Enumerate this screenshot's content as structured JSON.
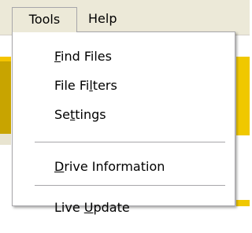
{
  "menubar": {
    "menus": [
      {
        "label": "Tools"
      },
      {
        "label": "Help"
      }
    ]
  },
  "dropdown": {
    "items": [
      {
        "pre": "",
        "mnemonic": "F",
        "post": "ind Files"
      },
      {
        "pre": "File Fi",
        "mnemonic": "l",
        "post": "ters"
      },
      {
        "pre": "Se",
        "mnemonic": "t",
        "post": "tings"
      },
      {
        "pre": "",
        "mnemonic": "D",
        "post": "rive Information"
      },
      {
        "pre": "Live ",
        "mnemonic": "U",
        "post": "pdate"
      }
    ]
  },
  "colors": {
    "menubar_bg": "#ece9d8",
    "menu_border": "#a7a6aa",
    "dropdown_bg": "#ffffff",
    "background_accent": "#f0c800"
  }
}
